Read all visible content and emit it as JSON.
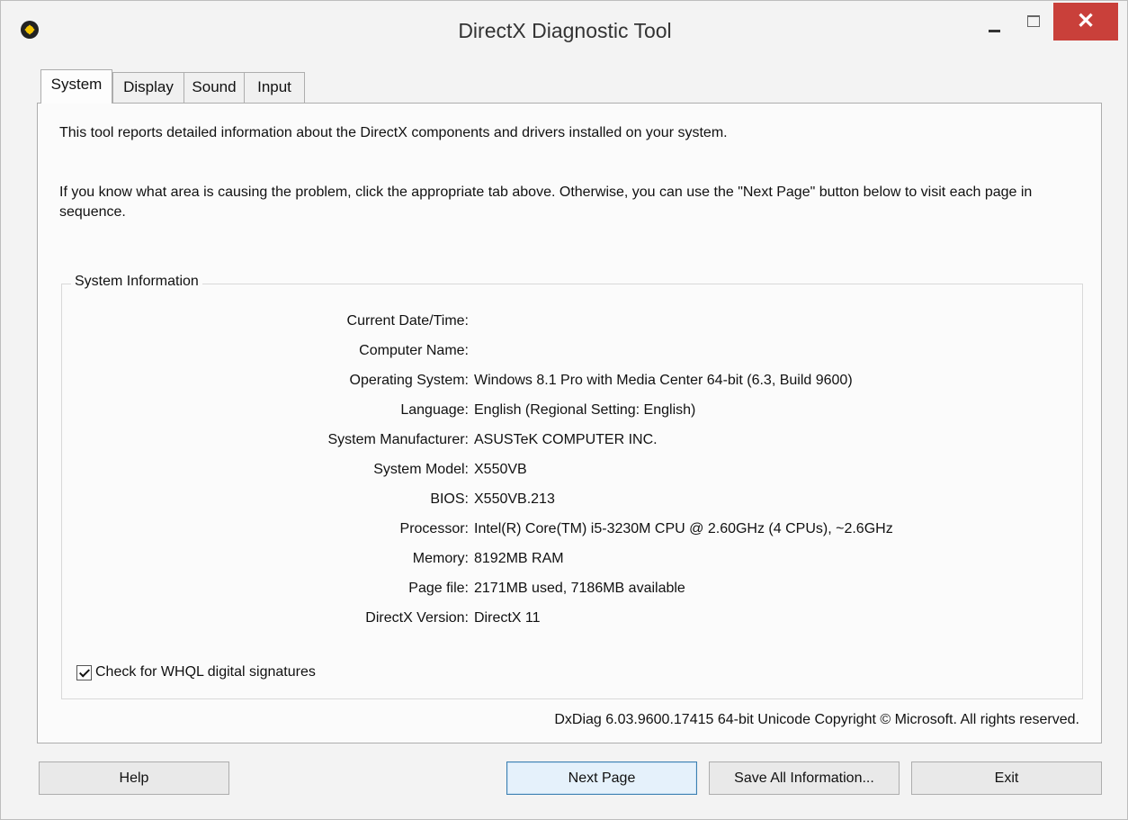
{
  "window": {
    "title": "DirectX Diagnostic Tool",
    "close_glyph": "✕",
    "icons": [
      "directx-icon",
      "minimize-icon",
      "maximize-icon",
      "close-icon"
    ],
    "close_color": "#c9403a"
  },
  "tabs": [
    {
      "label": "System",
      "active": true
    },
    {
      "label": "Display",
      "active": false
    },
    {
      "label": "Sound",
      "active": false
    },
    {
      "label": "Input",
      "active": false
    }
  ],
  "intro": {
    "line1": "This tool reports detailed information about the DirectX components and drivers installed on your system.",
    "line2": "If you know what area is causing the problem, click the appropriate tab above.  Otherwise, you can use the \"Next Page\" button below to visit each page in sequence."
  },
  "system_info": {
    "group_title": "System Information",
    "rows": [
      {
        "label": "Current Date/Time:",
        "value": ""
      },
      {
        "label": "Computer Name:",
        "value": ""
      },
      {
        "label": "Operating System:",
        "value": "Windows 8.1 Pro with Media Center 64-bit (6.3, Build 9600)"
      },
      {
        "label": "Language:",
        "value": "English (Regional Setting: English)"
      },
      {
        "label": "System Manufacturer:",
        "value": "ASUSTeK COMPUTER INC."
      },
      {
        "label": "System Model:",
        "value": "X550VB"
      },
      {
        "label": "BIOS:",
        "value": "X550VB.213"
      },
      {
        "label": "Processor:",
        "value": "Intel(R) Core(TM) i5-3230M CPU @ 2.60GHz (4 CPUs), ~2.6GHz"
      },
      {
        "label": "Memory:",
        "value": "8192MB RAM"
      },
      {
        "label": "Page file:",
        "value": "2171MB used, 7186MB available"
      },
      {
        "label": "DirectX Version:",
        "value": "DirectX 11"
      }
    ],
    "whql_checkbox": {
      "label": "Check for WHQL digital signatures",
      "checked": true
    }
  },
  "footer": {
    "copyright": "DxDiag 6.03.9600.17415 64-bit Unicode  Copyright © Microsoft. All rights reserved."
  },
  "buttons": {
    "help": "Help",
    "next_page": "Next Page",
    "save_all": "Save All Information...",
    "exit": "Exit"
  },
  "colors": {
    "window_bg": "#f3f3f3",
    "panel_bg": "#fbfbfb",
    "primary_button_border": "#3c7fb1"
  }
}
